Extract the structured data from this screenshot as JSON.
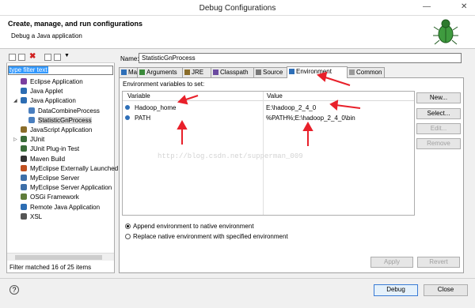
{
  "window": {
    "title": "Debug Configurations"
  },
  "header": {
    "title": "Create, manage, and run configurations",
    "subtitle": "Debug a Java application"
  },
  "left": {
    "filter_text": "type filter text",
    "tree": [
      {
        "label": "Eclipse Application",
        "icon": "eclipse-icon",
        "color": "#7b3fa0"
      },
      {
        "label": "Java Applet",
        "icon": "applet-icon",
        "color": "#2c6db3"
      },
      {
        "label": "Java Application",
        "icon": "java-app-icon",
        "color": "#2c6db3"
      },
      {
        "label": "DataCombineProcess",
        "icon": "java-config-icon",
        "color": "#4a7fbf"
      },
      {
        "label": "StatisticGnProcess",
        "icon": "java-config-icon",
        "color": "#4a7fbf"
      },
      {
        "label": "JavaScript Application",
        "icon": "js-icon",
        "color": "#8a6d2a"
      },
      {
        "label": "JUnit",
        "icon": "junit-icon",
        "color": "#3a6d3a"
      },
      {
        "label": "JUnit Plug-in Test",
        "icon": "junit-plugin-icon",
        "color": "#3a6d3a"
      },
      {
        "label": "Maven Build",
        "icon": "maven-icon",
        "color": "#333333"
      },
      {
        "label": "MyEclipse Externally Launched",
        "icon": "myeclipse-icon",
        "color": "#c05020"
      },
      {
        "label": "MyEclipse Server",
        "icon": "server-icon",
        "color": "#3d6fa8"
      },
      {
        "label": "MyEclipse Server Application",
        "icon": "server-app-icon",
        "color": "#3d6fa8"
      },
      {
        "label": "OSGi Framework",
        "icon": "osgi-icon",
        "color": "#5f7c3a"
      },
      {
        "label": "Remote Java Application",
        "icon": "remote-icon",
        "color": "#2c6db3"
      },
      {
        "label": "XSL",
        "icon": "xsl-icon",
        "color": "#555555"
      }
    ],
    "status": "Filter matched 16 of 25 items"
  },
  "main": {
    "name_label": "Name:",
    "name_value": "StatisticGnProcess",
    "tabs": [
      {
        "label": "Main"
      },
      {
        "label": "Arguments"
      },
      {
        "label": "JRE"
      },
      {
        "label": "Classpath"
      },
      {
        "label": "Source"
      },
      {
        "label": "Environment"
      },
      {
        "label": "Common"
      }
    ],
    "env_label": "Environment variables to set:",
    "col_variable": "Variable",
    "col_value": "Value",
    "rows": [
      {
        "variable": "Hadoop_home",
        "value": "E:\\hadoop_2_4_0"
      },
      {
        "variable": "PATH",
        "value": "%PATH%;E:\\hadoop_2_4_0\\bin"
      }
    ],
    "buttons": {
      "new": "New...",
      "select": "Select...",
      "edit": "Edit...",
      "remove": "Remove"
    },
    "radio_append": "Append environment to native environment",
    "radio_replace": "Replace native environment with specified environment",
    "apply": "Apply",
    "revert": "Revert"
  },
  "footer": {
    "debug": "Debug",
    "close": "Close"
  },
  "watermark": "http://blog.csdn.net/supperman_009",
  "colors": {
    "accent_red": "#e8202a",
    "selection": "#3399ff"
  }
}
